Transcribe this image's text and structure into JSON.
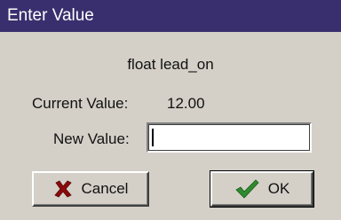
{
  "window": {
    "title": "Enter Value"
  },
  "dialog": {
    "variable_name": "float lead_on",
    "current_value_label": "Current Value:",
    "current_value": "12.00",
    "new_value_label": "New Value:",
    "new_value_input": ""
  },
  "buttons": {
    "cancel_label": "Cancel",
    "ok_label": "OK"
  },
  "colors": {
    "titlebar": "#3a2f6e",
    "dialog_bg": "#d4d0c8",
    "cancel_icon": "#8b0a0a",
    "ok_icon": "#2e8b2e"
  },
  "icons": {
    "cancel": "x-icon",
    "ok": "checkmark-icon"
  }
}
